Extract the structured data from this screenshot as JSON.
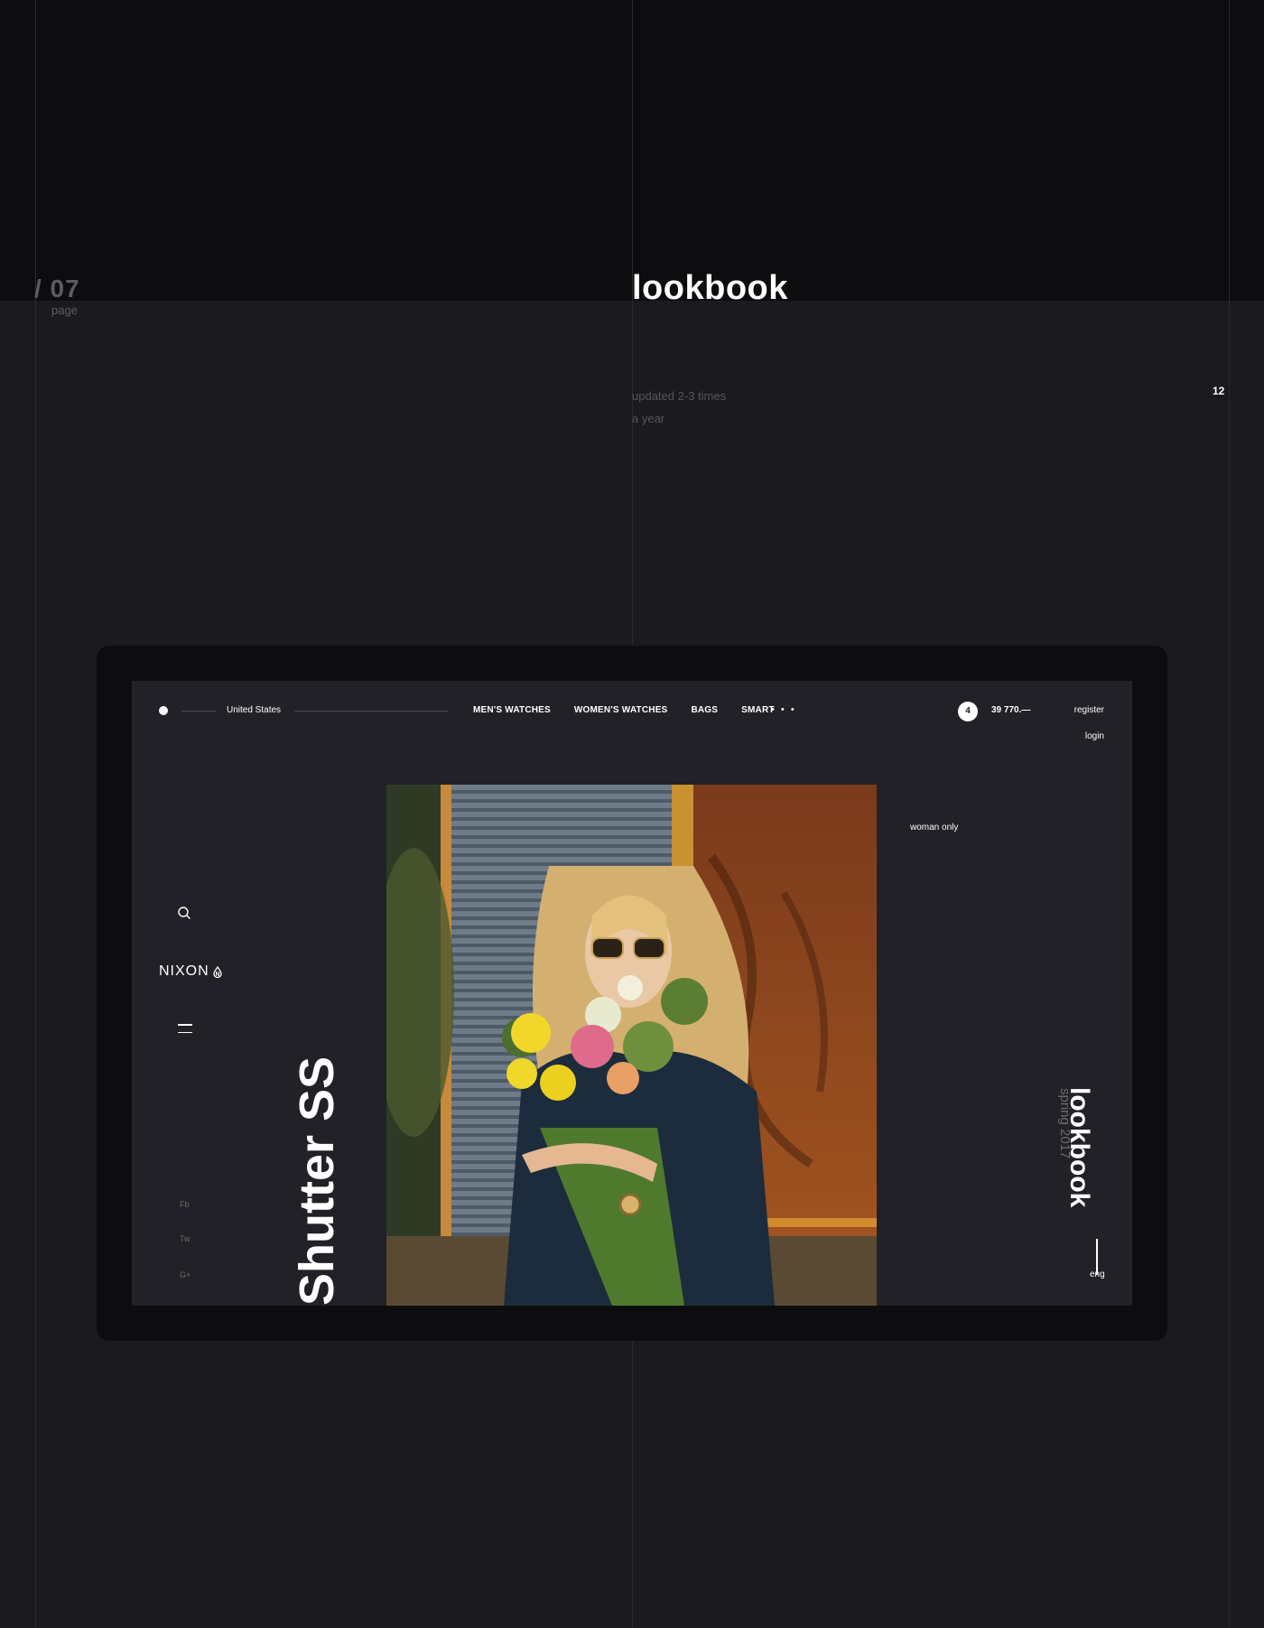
{
  "page": {
    "number": "/ 07",
    "label": "page"
  },
  "section": {
    "title": "lookbook",
    "note_line1": "updated 2-3 times",
    "note_line2": "a year",
    "count": "12"
  },
  "site": {
    "region": "United States",
    "nav": [
      "MEN'S WATCHES",
      "WOMEN'S WATCHES",
      "BAGS",
      "SMART"
    ],
    "more": "• • •",
    "cart_count": "4",
    "cart_total": "39 770.—",
    "register": "register",
    "login": "login",
    "brand": "NIXON",
    "social": [
      "Fb",
      "Tw",
      "G+"
    ],
    "hero_title": "Shutter SS",
    "tag": "woman only",
    "lookbook_title": "lookbook",
    "season": "spring 2017",
    "lang": "eng"
  },
  "colors": {
    "page_bg": "#1b1a1f",
    "top_band": "#0d0d0f",
    "device": "#0d0d0f",
    "screen": "#222127",
    "muted": "#5d5c62"
  },
  "icons": [
    "search-icon",
    "menu-icon",
    "nixon-logo-icon"
  ]
}
